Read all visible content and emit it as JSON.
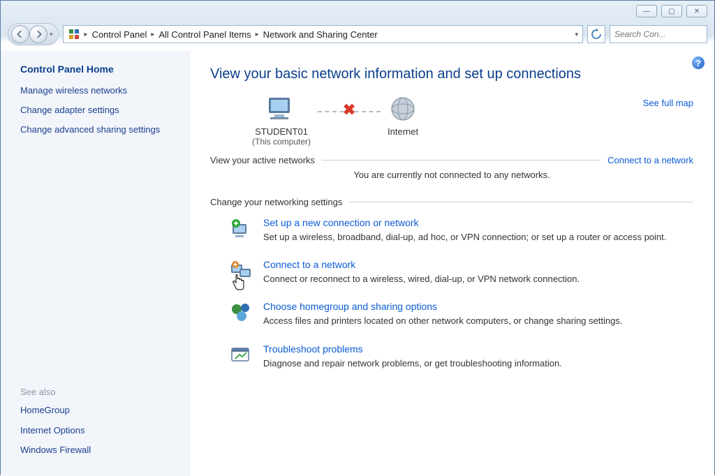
{
  "window_controls": {
    "minimize": "—",
    "maximize": "▢",
    "close": "✕"
  },
  "breadcrumb": {
    "items": [
      {
        "label": "Control Panel"
      },
      {
        "label": "All Control Panel Items"
      },
      {
        "label": "Network and Sharing Center"
      }
    ]
  },
  "search": {
    "placeholder": "Search Con..."
  },
  "sidebar": {
    "home": "Control Panel Home",
    "links": [
      "Manage wireless networks",
      "Change adapter settings",
      "Change advanced sharing settings"
    ],
    "see_also_label": "See also",
    "see_also": [
      "HomeGroup",
      "Internet Options",
      "Windows Firewall"
    ]
  },
  "main": {
    "title": "View your basic network information and set up connections",
    "see_full_map": "See full map",
    "map": {
      "computer_name": "STUDENT01",
      "computer_sub": "(This computer)",
      "internet_label": "Internet"
    },
    "active_networks_label": "View your active networks",
    "connect_link": "Connect to a network",
    "status_line": "You are currently not connected to any networks.",
    "change_settings_label": "Change your networking settings",
    "tasks": [
      {
        "title": "Set up a new connection or network",
        "desc": "Set up a wireless, broadband, dial-up, ad hoc, or VPN connection; or set up a router or access point."
      },
      {
        "title": "Connect to a network",
        "desc": "Connect or reconnect to a wireless, wired, dial-up, or VPN network connection."
      },
      {
        "title": "Choose homegroup and sharing options",
        "desc": "Access files and printers located on other network computers, or change sharing settings."
      },
      {
        "title": "Troubleshoot problems",
        "desc": "Diagnose and repair network problems, or get troubleshooting information."
      }
    ]
  }
}
